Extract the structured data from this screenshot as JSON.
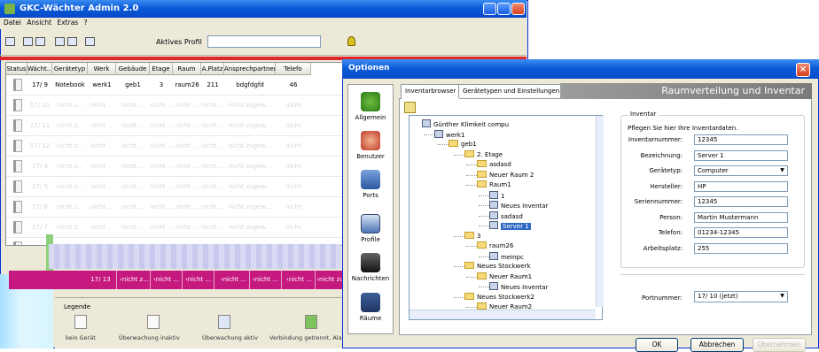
{
  "main_window": {
    "title": "GKC-Wächter Admin 2.0",
    "menu": [
      "Datei",
      "Ansicht",
      "Extras",
      "?"
    ],
    "toolbar": {
      "profile_label": "Aktives Profil",
      "profile_value": ""
    },
    "table": {
      "columns": [
        "Status",
        "Wächt...",
        "Gerätetyp",
        "Werk",
        "Gebäude",
        "Etage",
        "Raum",
        "A.Platz",
        "Ansprechpartner",
        "Telefo"
      ],
      "first_row": [
        "",
        "17/ 9",
        "Notebook",
        "werk1",
        "geb1",
        "3",
        "raum26",
        "211",
        "bdgfdgfd",
        "46"
      ],
      "dim_rows": [
        [
          "",
          "17/ 10",
          "nicht z...",
          "nicht ...",
          "nicht ...",
          "nicht ...",
          "nicht ...",
          "nicht ...",
          "nicht zugew...",
          "nicht"
        ],
        [
          "",
          "17/ 11",
          "nicht z...",
          "nicht ...",
          "nicht ...",
          "nicht ...",
          "nicht ...",
          "nicht ...",
          "nicht zugew...",
          "nicht"
        ],
        [
          "",
          "17/ 12",
          "nicht z...",
          "nicht ...",
          "nicht ...",
          "nicht ...",
          "nicht ...",
          "nicht ...",
          "nicht zugew...",
          "nicht"
        ],
        [
          "",
          "17/ 4",
          "nicht z...",
          "nicht ...",
          "nicht ...",
          "nicht ...",
          "nicht ...",
          "nicht ...",
          "nicht zugew...",
          "nicht"
        ],
        [
          "",
          "17/ 5",
          "nicht z...",
          "nicht ...",
          "nicht ...",
          "nicht ...",
          "nicht ...",
          "nicht ...",
          "nicht zugew...",
          "nicht"
        ],
        [
          "",
          "17/ 6",
          "nicht z...",
          "nicht ...",
          "nicht ...",
          "nicht ...",
          "nicht ...",
          "nicht ...",
          "nicht zugew...",
          "nicht"
        ],
        [
          "",
          "17/ 7",
          "nicht z...",
          "nicht ...",
          "nicht ...",
          "nicht ...",
          "nicht ...",
          "nicht ...",
          "nicht zugew...",
          "nicht"
        ],
        [
          "",
          "17/ 8",
          "nicht z...",
          "nicht ...",
          "nicht ...",
          "nicht ...",
          "nicht ...",
          "nicht ...",
          "nicht zugew...",
          "nicht"
        ]
      ],
      "selected_row": [
        "17/ 13",
        "‹nicht z...",
        "‹nicht ...",
        "‹nicht ...",
        "‹nicht ...",
        "‹nicht ...",
        "‹nicht ...",
        "‹nicht zu"
      ]
    },
    "legend": {
      "title": "Legende",
      "items": [
        "kein Gerät",
        "Überwachung inaktiv",
        "Überwachung aktiv",
        "Verbindung getrennt, Alar"
      ]
    }
  },
  "dialog": {
    "title": "Optionen",
    "sidebar": [
      "Allgemein",
      "Benutzer",
      "Ports",
      "Profile",
      "Nachrichten",
      "Räume"
    ],
    "tabs": [
      "Inventarbrowser",
      "Gerätetypen und Einstellungen"
    ],
    "banner": "Raumverteilung und Inventar",
    "tree": [
      {
        "label": "Günther Klimkeit compu",
        "icon": "pc"
      },
      {
        "label": "werk1",
        "icon": "pc"
      },
      {
        "label": "geb1",
        "icon": "folder"
      },
      {
        "label": "2. Etage",
        "icon": "folder"
      },
      {
        "label": "asdasd",
        "icon": "folder"
      },
      {
        "label": "Neuer Raum 2",
        "icon": "folder"
      },
      {
        "label": "Raum1",
        "icon": "folder"
      },
      {
        "label": "1",
        "icon": "pc"
      },
      {
        "label": "Neues Inventar",
        "icon": "pc"
      },
      {
        "label": "sadasd",
        "icon": "pc"
      },
      {
        "label": "Server 1",
        "icon": "pc",
        "selected": true
      },
      {
        "label": "3",
        "icon": "folder"
      },
      {
        "label": "raum26",
        "icon": "folder"
      },
      {
        "label": "meinpc",
        "icon": "pc"
      },
      {
        "label": "Neues Stockwerk",
        "icon": "folder"
      },
      {
        "label": "Neuer Raum1",
        "icon": "folder"
      },
      {
        "label": "Neues Inventar",
        "icon": "pc"
      },
      {
        "label": "Neues Stockwerk2",
        "icon": "folder"
      },
      {
        "label": "Neuer Raum2",
        "icon": "folder"
      }
    ],
    "inventar": {
      "legend": "Inventar",
      "description": "Pflegen Sie hier Ihre Inventardaten.",
      "fields": [
        {
          "label": "Inventarnummer:",
          "value": "12345"
        },
        {
          "label": "Bezeichnung:",
          "value": "Server 1"
        },
        {
          "label": "Gerätetyp:",
          "value": "Computer"
        },
        {
          "label": "Hersteller:",
          "value": "HP"
        },
        {
          "label": "Seriennummer:",
          "value": "12345"
        },
        {
          "label": "Person:",
          "value": "Martin Mustermann"
        },
        {
          "label": "Telefon:",
          "value": "01234-12345"
        },
        {
          "label": "Arbeitsplatz:",
          "value": "255"
        }
      ]
    },
    "port": {
      "label": "Portnummer:",
      "value": "17/ 10 (jetzt)"
    },
    "buttons": {
      "ok": "OK",
      "cancel": "Abbrechen",
      "apply": "Übernehmen"
    }
  }
}
